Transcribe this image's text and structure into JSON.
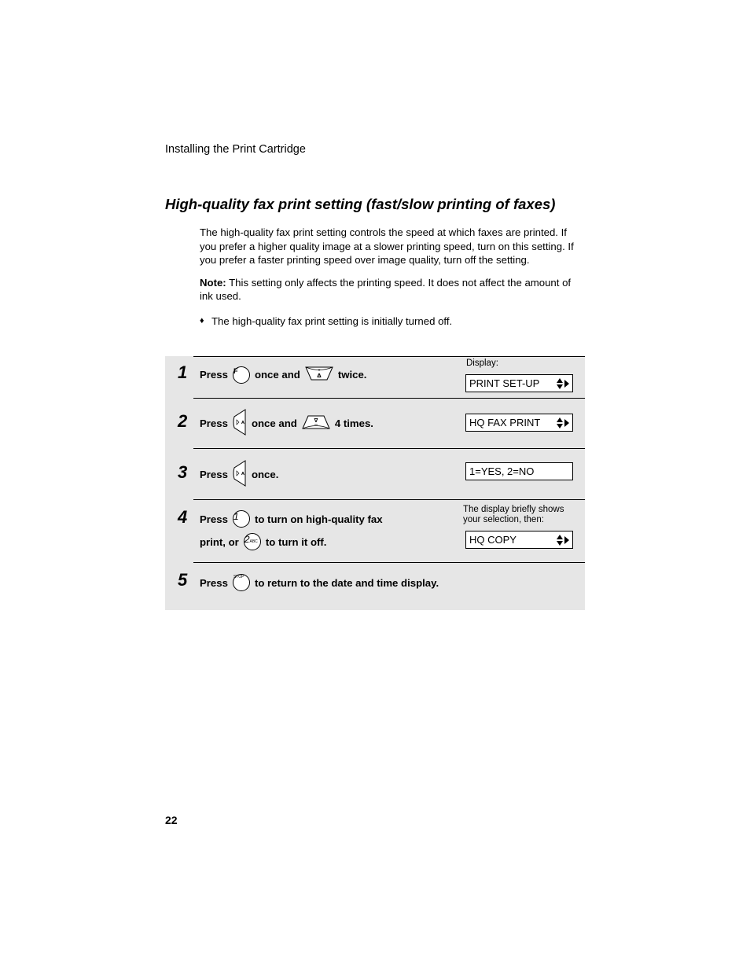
{
  "running_head": "Installing the Print Cartridge",
  "section_title": "High-quality fax print setting (fast/slow printing of faxes)",
  "intro": {
    "paragraph": "The high-quality fax print setting controls the speed at which faxes are printed. If you prefer a higher quality image at a slower printing speed, turn on this setting. If you prefer a faster printing speed over image quality, turn off the setting.",
    "note_label": "Note:",
    "note_text": " This setting only affects the printing speed. It does not affect the amount of ink used.",
    "bullet_glyph": "♦",
    "bullet_text": "The high-quality fax print setting is initially turned off."
  },
  "steps": [
    {
      "number": "1",
      "parts": [
        "Press",
        "once and",
        "twice."
      ],
      "keys": [
        {
          "icon": "function-key-icon",
          "label": "F"
        },
        {
          "icon": "up-arrow-key-icon",
          "label": ""
        }
      ],
      "display_label": "Display:",
      "display": "PRINT SET-UP",
      "display_arrows": true
    },
    {
      "number": "2",
      "parts": [
        "Press",
        "once and",
        "4 times."
      ],
      "keys": [
        {
          "icon": "start-memory-key-icon",
          "label": ""
        },
        {
          "icon": "down-arrow-key-icon",
          "label": ""
        }
      ],
      "display": "HQ FAX PRINT",
      "display_arrows": true
    },
    {
      "number": "3",
      "parts": [
        "Press",
        "once."
      ],
      "keys": [
        {
          "icon": "start-memory-key-icon",
          "label": ""
        }
      ],
      "display": "1=YES, 2=NO",
      "display_arrows": false
    },
    {
      "number": "4",
      "line1": [
        "Press",
        "to turn on high-quality fax"
      ],
      "line2": [
        "print, or",
        "to turn it off."
      ],
      "keys": [
        {
          "icon": "number-1-key-icon",
          "label": "1"
        },
        {
          "icon": "number-2-key-icon",
          "label": "2",
          "sub": "ABC"
        }
      ],
      "display_note": "The display briefly shows your selection, then:",
      "display": "HQ COPY",
      "display_arrows": true
    },
    {
      "number": "5",
      "parts": [
        "Press",
        "to return to the date and time display."
      ],
      "keys": [
        {
          "icon": "stop-key-icon",
          "label": "STOP"
        }
      ]
    }
  ],
  "page_number": "22"
}
